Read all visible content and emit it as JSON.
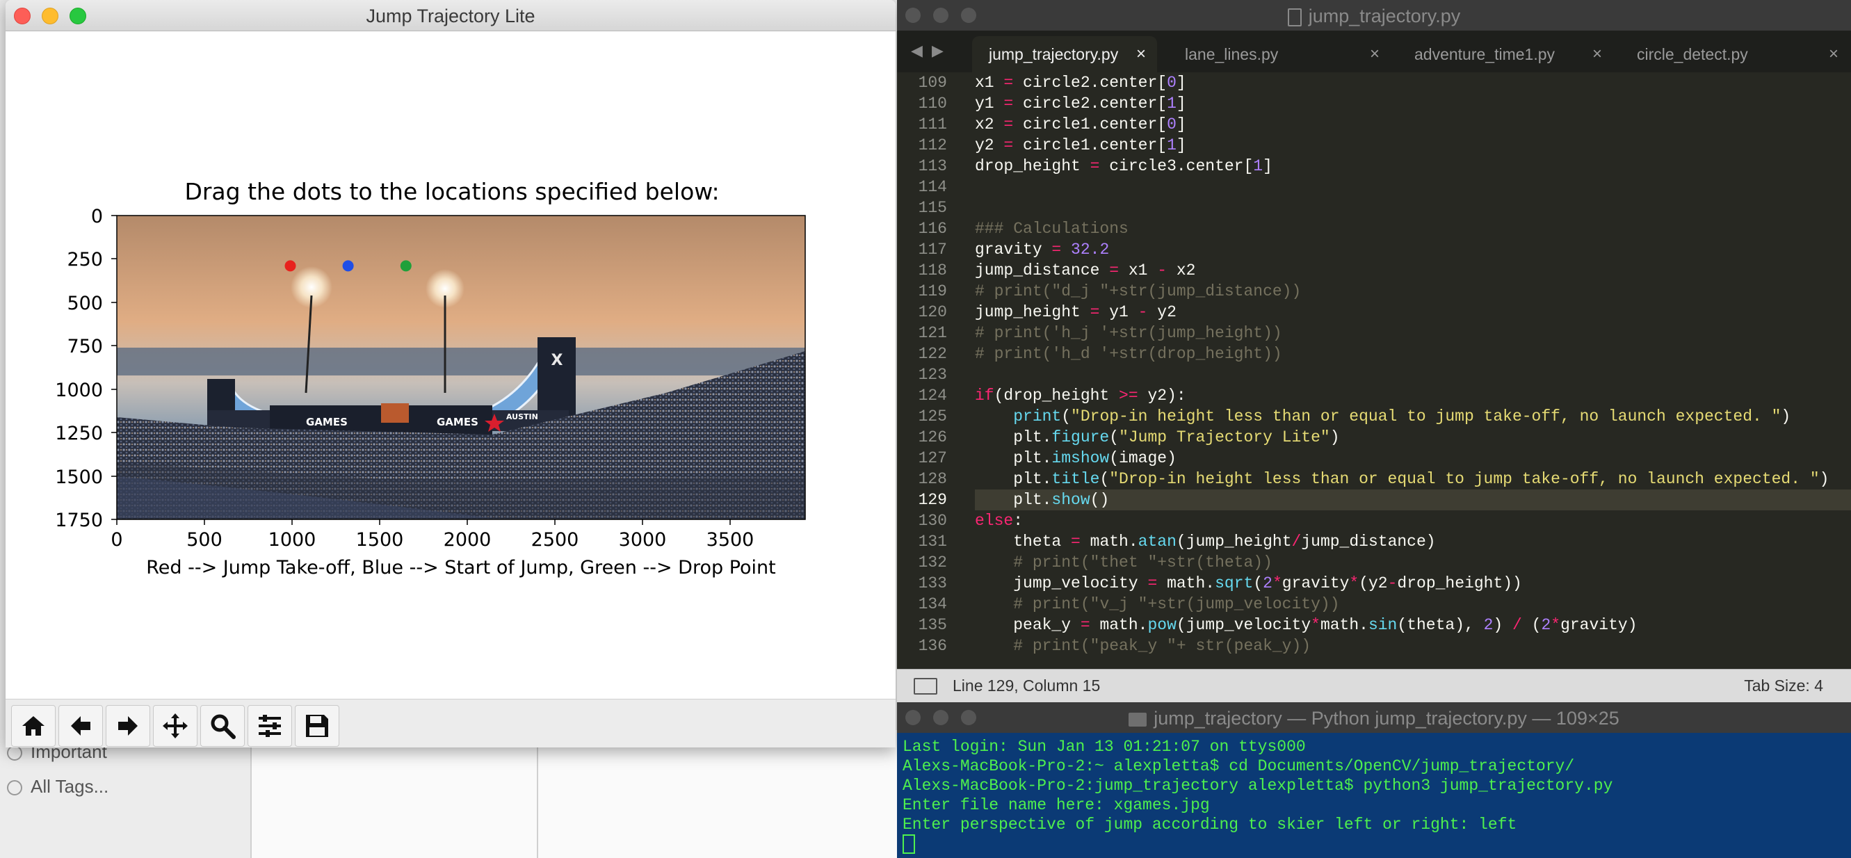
{
  "background_finder": {
    "tags": [
      "Important",
      "All Tags..."
    ]
  },
  "mpl_window": {
    "title": "Jump Trajectory Lite",
    "plot_title": "Drag the dots to the locations specified below:",
    "xlabel": "Red --> Jump Take-off, Blue --> Start of Jump, Green --> Drop Point",
    "x_ticks": [
      "0",
      "500",
      "1000",
      "1500",
      "2000",
      "2500",
      "3000",
      "3500"
    ],
    "y_ticks": [
      "0",
      "250",
      "500",
      "750",
      "1000",
      "1250",
      "1500",
      "1750"
    ],
    "image_text": [
      "GAMES",
      "GAMES",
      "AUSTIN"
    ],
    "dots": [
      {
        "name": "red-dot",
        "color": "#e8221d",
        "x": 990,
        "y": 290
      },
      {
        "name": "blue-dot",
        "color": "#1f4ee6",
        "x": 1320,
        "y": 290
      },
      {
        "name": "green-dot",
        "color": "#1ea03a",
        "x": 1650,
        "y": 290
      }
    ],
    "toolbar": [
      "home-icon",
      "back-icon",
      "forward-icon",
      "pan-icon",
      "zoom-icon",
      "configure-icon",
      "save-icon"
    ]
  },
  "editor": {
    "title": "jump_trajectory.py",
    "tabs": [
      {
        "label": "jump_trajectory.py",
        "active": true
      },
      {
        "label": "lane_lines.py",
        "active": false
      },
      {
        "label": "adventure_time1.py",
        "active": false
      },
      {
        "label": "circle_detect.py",
        "active": false
      }
    ],
    "tab_close": "×",
    "nav_back": "◀",
    "nav_forward": "▶",
    "line_numbers": [
      "109",
      "110",
      "111",
      "112",
      "113",
      "114",
      "115",
      "116",
      "117",
      "118",
      "119",
      "120",
      "121",
      "122",
      "123",
      "124",
      "125",
      "126",
      "127",
      "128",
      "129",
      "130",
      "131",
      "132",
      "133",
      "134",
      "135",
      "136"
    ],
    "current_line": "129",
    "status_left": "Line 129, Column 15",
    "status_right": "Tab Size: 4",
    "colors": {
      "keyword": "#f92672",
      "number": "#ae81ff",
      "string": "#e6db74",
      "func": "#66d9ef",
      "comment": "#75715e",
      "default": "#f8f8f2"
    }
  },
  "terminal": {
    "title": "jump_trajectory — Python jump_trajectory.py — 109×25",
    "lines": [
      "Last login: Sun Jan 13 01:21:07 on ttys000",
      "Alexs-MacBook-Pro-2:~ alexpletta$ cd Documents/OpenCV/jump_trajectory/",
      "Alexs-MacBook-Pro-2:jump_trajectory alexpletta$ python3 jump_trajectory.py",
      "Enter file name here: xgames.jpg",
      "Enter perspective of jump according to skier left or right: left"
    ]
  }
}
